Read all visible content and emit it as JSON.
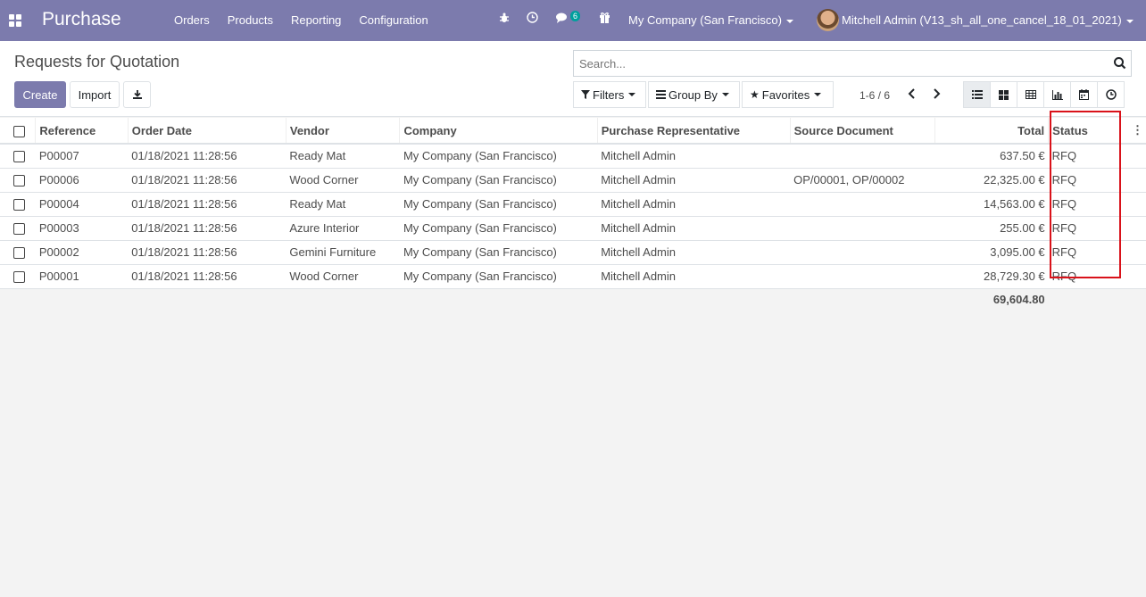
{
  "navbar": {
    "app_name": "Purchase",
    "menu": [
      "Orders",
      "Products",
      "Reporting",
      "Configuration"
    ],
    "message_badge": "6",
    "company": "My Company (San Francisco)",
    "user": "Mitchell Admin (V13_sh_all_one_cancel_18_01_2021)"
  },
  "control": {
    "title": "Requests for Quotation",
    "create_label": "Create",
    "import_label": "Import",
    "search_placeholder": "Search...",
    "filters_label": "Filters",
    "groupby_label": "Group By",
    "favorites_label": "Favorites",
    "pager": "1-6 / 6"
  },
  "table": {
    "headers": [
      "Reference",
      "Order Date",
      "Vendor",
      "Company",
      "Purchase Representative",
      "Source Document",
      "Total",
      "Status"
    ],
    "rows": [
      [
        "P00007",
        "01/18/2021 11:28:56",
        "Ready Mat",
        "My Company (San Francisco)",
        "Mitchell Admin",
        "",
        "637.50 €",
        "RFQ"
      ],
      [
        "P00006",
        "01/18/2021 11:28:56",
        "Wood Corner",
        "My Company (San Francisco)",
        "Mitchell Admin",
        "OP/00001, OP/00002",
        "22,325.00 €",
        "RFQ"
      ],
      [
        "P00004",
        "01/18/2021 11:28:56",
        "Ready Mat",
        "My Company (San Francisco)",
        "Mitchell Admin",
        "",
        "14,563.00 €",
        "RFQ"
      ],
      [
        "P00003",
        "01/18/2021 11:28:56",
        "Azure Interior",
        "My Company (San Francisco)",
        "Mitchell Admin",
        "",
        "255.00 €",
        "RFQ"
      ],
      [
        "P00002",
        "01/18/2021 11:28:56",
        "Gemini Furniture",
        "My Company (San Francisco)",
        "Mitchell Admin",
        "",
        "3,095.00 €",
        "RFQ"
      ],
      [
        "P00001",
        "01/18/2021 11:28:56",
        "Wood Corner",
        "My Company (San Francisco)",
        "Mitchell Admin",
        "",
        "28,729.30 €",
        "RFQ"
      ]
    ],
    "sum_total": "69,604.80"
  },
  "colors": {
    "brand": "#7c7bad",
    "highlight": "#d9121a",
    "badge": "#00a09d"
  }
}
